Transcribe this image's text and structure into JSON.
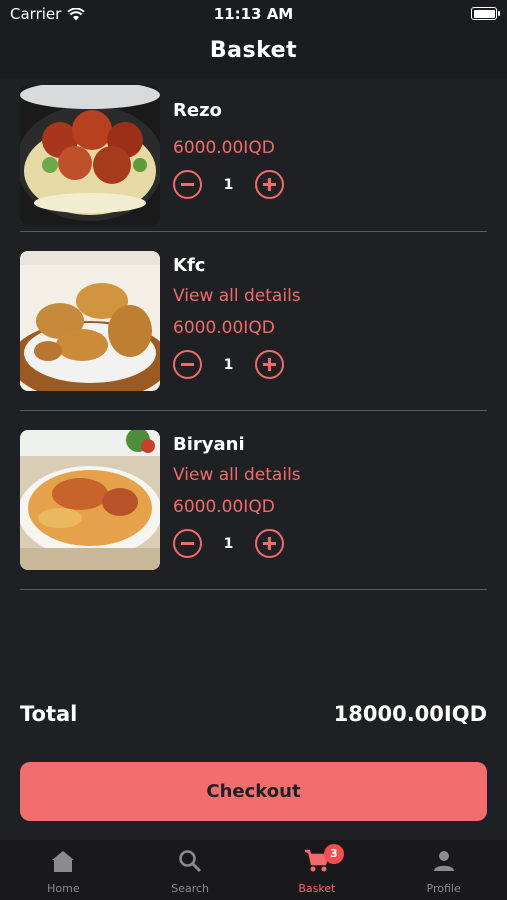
{
  "status_bar": {
    "carrier": "Carrier",
    "time": "11:13 AM"
  },
  "header": {
    "title": "Basket"
  },
  "basket": {
    "items": [
      {
        "name": "Rezo",
        "details": "",
        "price": "6000.00IQD",
        "quantity": "1"
      },
      {
        "name": "Kfc",
        "details": "View all details",
        "price": "6000.00IQD",
        "quantity": "1"
      },
      {
        "name": "Biryani",
        "details": "View all details",
        "price": "6000.00IQD",
        "quantity": "1"
      }
    ]
  },
  "summary": {
    "total_label": "Total",
    "total_value": "18000.00IQD"
  },
  "checkout": {
    "label": "Checkout"
  },
  "tab_bar": {
    "tabs": [
      {
        "label": "Home",
        "icon": "home-icon"
      },
      {
        "label": "Search",
        "icon": "search-icon"
      },
      {
        "label": "Basket",
        "icon": "cart-icon",
        "badge": "3"
      },
      {
        "label": "Profile",
        "icon": "person-icon"
      }
    ]
  },
  "colors": {
    "accent": "#f26a6a",
    "background": "#1f2023",
    "button": "#f26e6e"
  }
}
